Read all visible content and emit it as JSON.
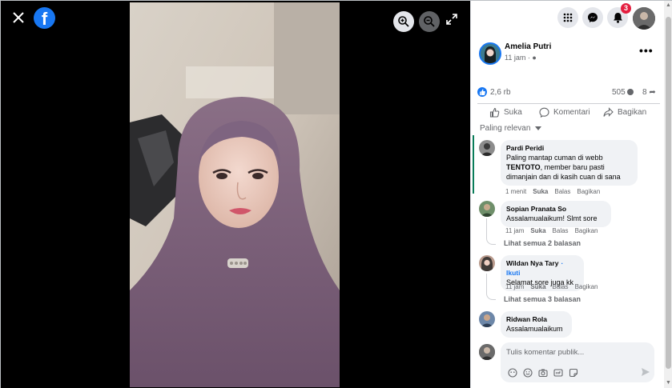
{
  "viewer": {
    "close_icon": "close-icon",
    "logo_letter": "f",
    "zoom_in_icon": "zoom-in-icon",
    "zoom_out_icon": "zoom-out-icon",
    "fullscreen_icon": "expand-icon"
  },
  "topbar": {
    "menu_icon": "grid-menu-icon",
    "messenger_icon": "messenger-icon",
    "notifications_icon": "bell-icon",
    "notification_count": "3",
    "account_icon": "avatar"
  },
  "post": {
    "author_name": "Amelia Putri",
    "time": "11 jam ·",
    "privacy_icon": "globe-icon",
    "likes": "2,6 rb",
    "comments": "505",
    "shares": "8",
    "actions": {
      "like": "Suka",
      "comment": "Komentari",
      "share": "Bagikan"
    },
    "sort_label": "Paling relevan"
  },
  "comments": [
    {
      "name": "Pardi Peridi",
      "text_before": "Paling mantap cuman di webb ",
      "text_bold": "TENTOTO",
      "text_after": ", member baru pasti dimanjain dan di kasih cuan di sana",
      "time": "1 menit",
      "like": "Suka",
      "reply": "Balas",
      "share": "Bagikan"
    },
    {
      "name": "Sopian Pranata So",
      "text": "Assalamualaikum! Slmt sore",
      "time": "11 jam",
      "like": "Suka",
      "reply": "Balas",
      "share": "Bagikan",
      "replies": "Lihat semua 2 balasan"
    },
    {
      "name": "Wildan Nya Tary",
      "follow": "· Ikuti",
      "text": "Selamat sore juga kk",
      "time": "11 jam",
      "like": "Suka",
      "reply": "Balas",
      "share": "Bagikan",
      "replies": "Lihat semua 3 balasan"
    },
    {
      "name": "Ridwan Rola",
      "text": "Assalamualaikum"
    }
  ],
  "composer": {
    "placeholder": "Tulis komentar publik...",
    "tool_icons": [
      "avatar-sticker-icon",
      "emoji-icon",
      "camera-icon",
      "gif-icon",
      "sticker-icon"
    ],
    "send_icon": "send-icon"
  },
  "colors": {
    "brand": "#1877f2",
    "badge": "#e41e3f",
    "bubble": "#f0f2f5",
    "secondary_text": "#65676b"
  }
}
